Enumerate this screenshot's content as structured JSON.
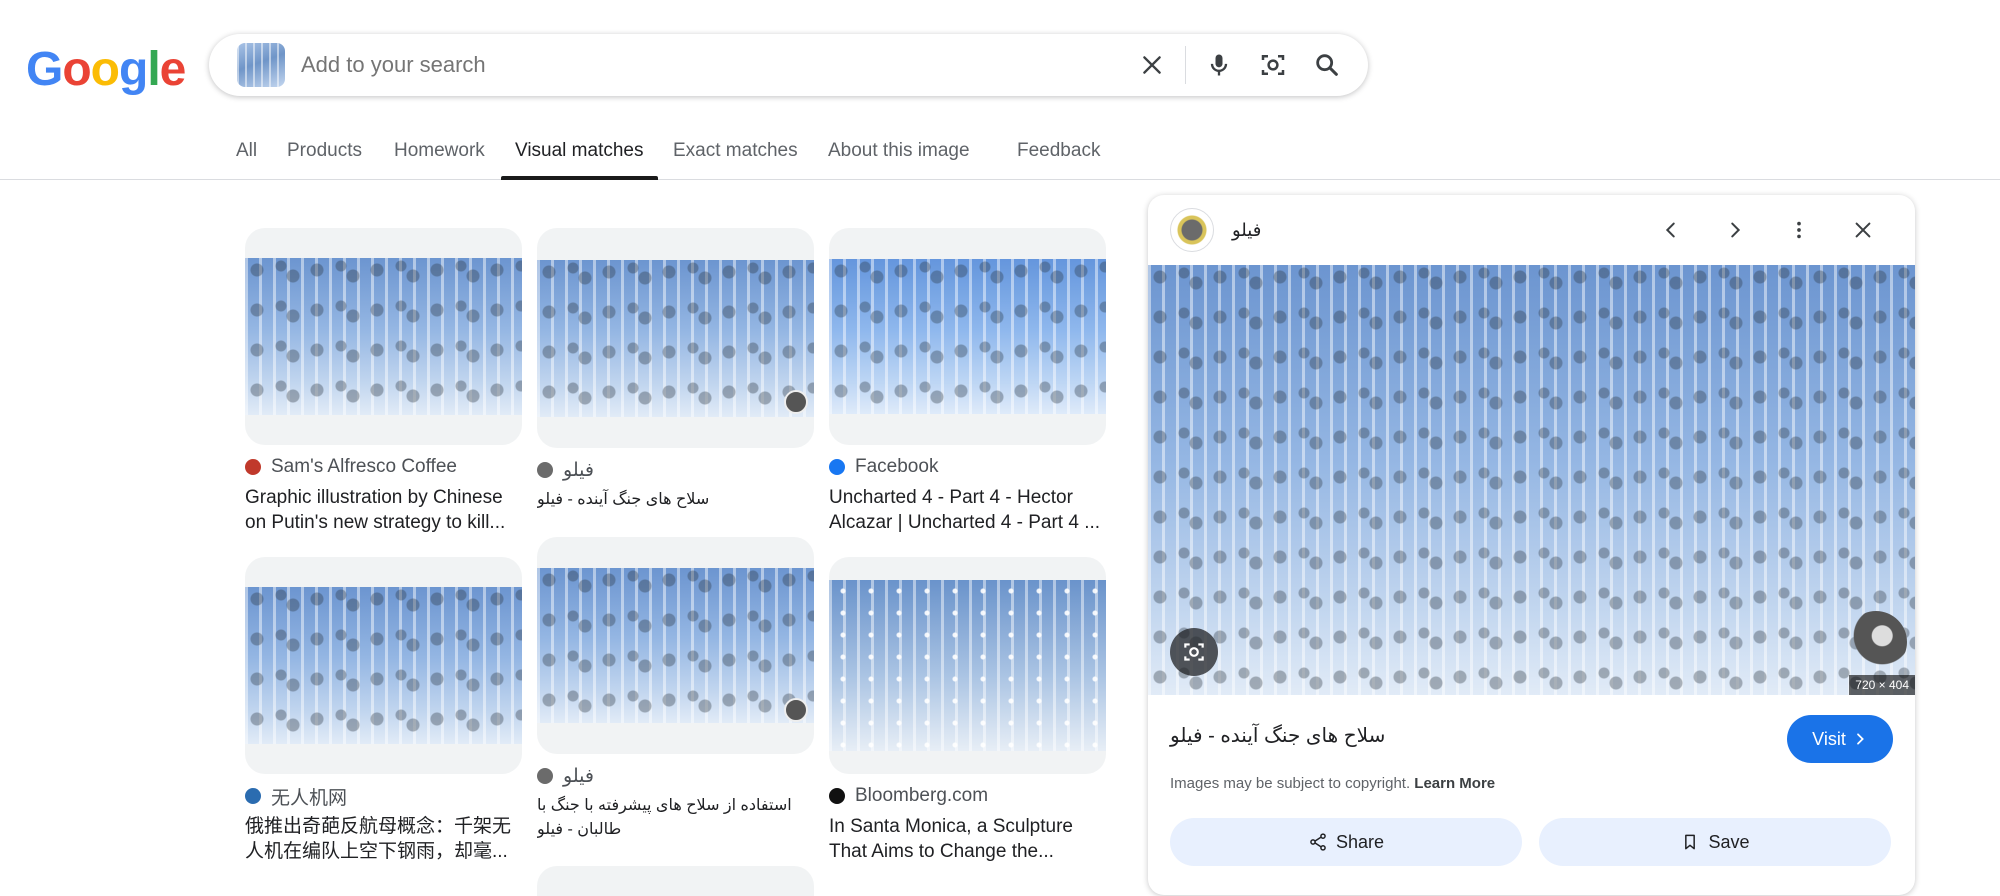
{
  "logo": {
    "text": "Google",
    "letters": [
      "G",
      "o",
      "o",
      "g",
      "l",
      "e"
    ],
    "colors": [
      "#4285F4",
      "#EA4335",
      "#FBBC05",
      "#4285F4",
      "#34A853",
      "#EA4335"
    ]
  },
  "search": {
    "placeholder": "Add to your search",
    "value": ""
  },
  "tabs": [
    {
      "label": "All"
    },
    {
      "label": "Products"
    },
    {
      "label": "Homework"
    },
    {
      "label": "Visual matches",
      "active": true
    },
    {
      "label": "Exact matches"
    },
    {
      "label": "About this image"
    },
    {
      "label": "Feedback"
    }
  ],
  "results": [
    {
      "source": "Sam's Alfresco Coffee",
      "title": "Graphic illustration by Chinese on Putin's new strategy to kill...",
      "fav_color": "#c0392b"
    },
    {
      "source": "فیلو",
      "title": "سلاح های جنگ آینده - فیلو",
      "fav_color": "#6b6b6b"
    },
    {
      "source": "Facebook",
      "title": "Uncharted 4 - Part 4 - Hector Alcazar | Uncharted 4 - Part 4 ...",
      "fav_color": "#1877F2"
    },
    {
      "source": "无人机网",
      "title": "俄推出奇葩反航母概念：千架无人机在编队上空下钢雨，却毫...",
      "fav_color": "#2b6cb0"
    },
    {
      "source": "فیلو",
      "title": "استفاده از سلاح های پیشرفته با جنگ با طالبان - فیلو",
      "fav_color": "#6b6b6b"
    },
    {
      "source": "Bloomberg.com",
      "title": "In Santa Monica, a Sculpture That Aims to Change the...",
      "fav_color": "#111111"
    }
  ],
  "panel": {
    "source": "فیلو",
    "title": "سلاح های جنگ آینده - فیلو",
    "dimensions": "720 × 404",
    "visit_label": "Visit",
    "copyright_text": "Images may be subject to copyright.",
    "learn_more": "Learn More",
    "share_label": "Share",
    "save_label": "Save"
  },
  "colors": {
    "accent": "#1a73e8",
    "action_bg": "#e8f0fe"
  }
}
